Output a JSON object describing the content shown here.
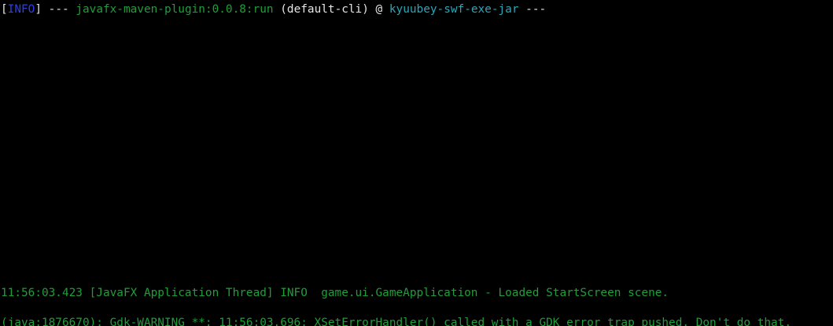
{
  "colors": {
    "background": "#000000",
    "default_text": "#e6e6e6",
    "info_tag": "#2f3fe6",
    "plugin_text": "#1f9e3a",
    "project_text": "#2aa6b8",
    "log_text": "#1f9e3a"
  },
  "lines": [
    {
      "segments": {
        "bracket_open": "[",
        "info_tag": "INFO",
        "bracket_close": "]",
        "dashes_1": " --- ",
        "plugin": "javafx-maven-plugin:0.0.8:run",
        "execution": " (default-cli) @ ",
        "project": "kyuubey-swf-exe-jar",
        "dashes_2": " ---"
      }
    },
    {
      "text": "11:56:03.423 [JavaFX Application Thread] INFO  game.ui.GameApplication - Loaded StartScreen scene."
    },
    {
      "text": "(java:1876670): Gdk-WARNING **: 11:56:03.696: XSetErrorHandler() called with a GDK error trap pushed. Don't do that."
    }
  ]
}
